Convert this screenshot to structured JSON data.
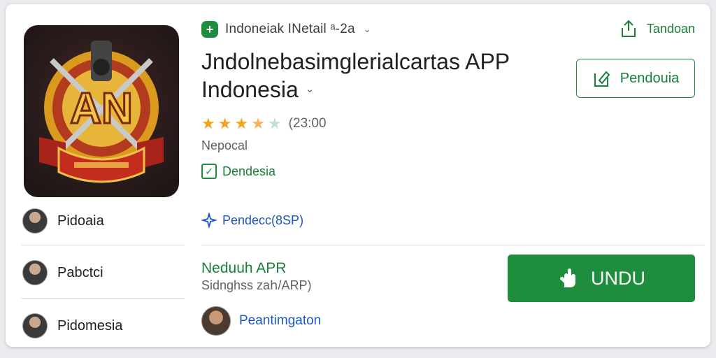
{
  "developer": {
    "badge_icon": "plus-badge-icon",
    "name": "Indoneiak INetail ᵃ-2a",
    "chevron": "⌄"
  },
  "share": {
    "icon": "share-icon",
    "label": "Tandoan"
  },
  "app": {
    "title_line1": "Jndolnebasimglerialcartas APP",
    "title_line2": "Indonesia",
    "rating_text": "(23:00",
    "rating_stars": 3.5,
    "category": "Nepocal",
    "country": "Dendesia",
    "link_text": "Pendecc(8SP)"
  },
  "wishlist_button": {
    "icon": "bookmark-icon",
    "label": "Pendouia"
  },
  "sidebar": {
    "items": [
      {
        "label": "Pidoaia"
      },
      {
        "label": "Pabctci"
      },
      {
        "label": "Pidomesia"
      }
    ]
  },
  "section": {
    "title": "Neduuh APR",
    "subtitle": "Sidnghss zaհ/ARP)"
  },
  "install": {
    "icon": "hand-icon",
    "label": "UNDU"
  },
  "developer_person": {
    "name": "Peantimgaton"
  },
  "colors": {
    "accent_green": "#1e8e3e",
    "link_blue": "#1a56c7",
    "star_gold": "#f4a21f"
  }
}
